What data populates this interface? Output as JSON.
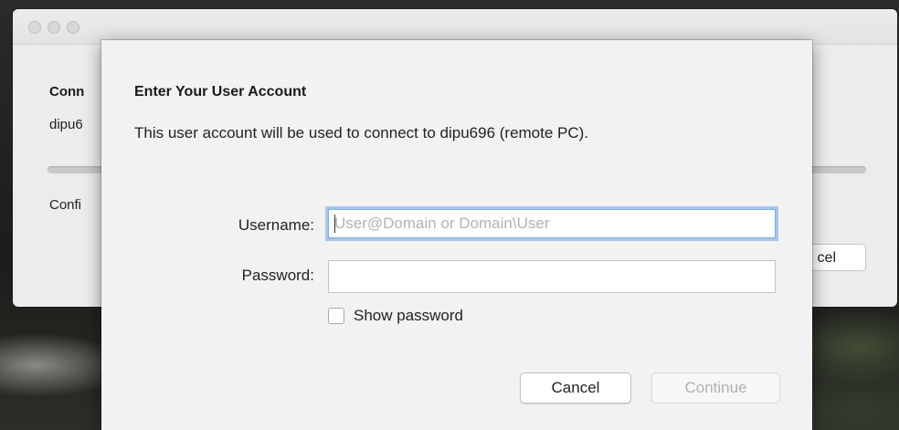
{
  "background_window": {
    "heading": "Conn",
    "subtext": "dipu6",
    "status": "Confi",
    "cancel_label": "cel"
  },
  "dialog": {
    "title": "Enter Your User Account",
    "description": "This user account will be used to connect to dipu696 (remote PC).",
    "username_label": "Username:",
    "username_value": "",
    "username_placeholder": "User@Domain or Domain\\User",
    "password_label": "Password:",
    "password_value": "",
    "show_password_label": "Show password",
    "show_password_checked": false,
    "cancel_label": "Cancel",
    "continue_label": "Continue",
    "continue_enabled": false
  },
  "colors": {
    "focus_ring": "#69a0e1",
    "dialog_bg": "#f2f2f2",
    "window_bg": "#ececec"
  }
}
